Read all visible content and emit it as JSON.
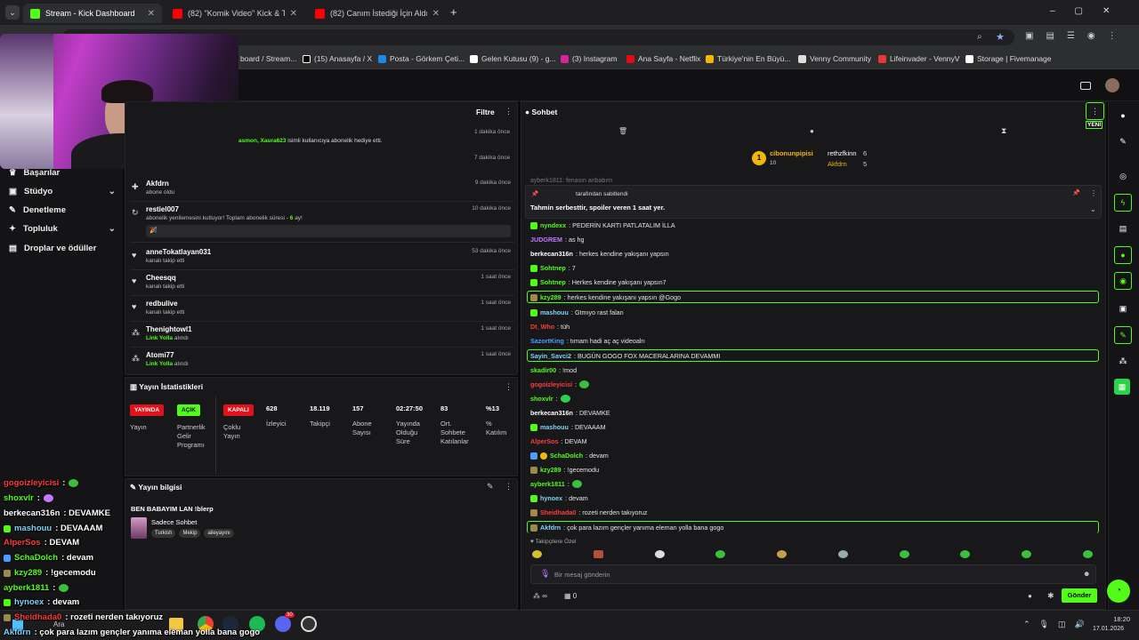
{
  "browser": {
    "tabs": [
      {
        "label": "Stream - Kick Dashboard"
      },
      {
        "label": "(82) \"Komik Video\" Kick & Twitc"
      },
      {
        "label": "(82) Canım İstediği İçin Aldıkla"
      }
    ],
    "bookmarks": [
      "board / Stream...",
      "(15) Anasayfa / X",
      "Posta - Görkem Çeti...",
      "Gelen Kutusu (9) - g...",
      "(3) Instagram",
      "Ana Sayfa - Netflix",
      "Türkiye'nin En Büyü...",
      "Venny Community",
      "Lifeinvader - VennyV",
      "Storage | Fivemanage"
    ]
  },
  "sidebar": {
    "items": [
      "Başarılar",
      "Stüdyo",
      "Denetleme",
      "Topluluk",
      "Droplar ve ödüller"
    ]
  },
  "activity": {
    "filter_label": "Filtre",
    "first_time": "1 dakika önce",
    "gift_text_names": "asmon, Xaura623",
    "gift_text": "isimli kullanıcıya abonelik hediye etti.",
    "second_time": "7 dakika önce",
    "rows": [
      {
        "name": "Akfdrn",
        "sub": "abone oldu",
        "time": "9 dakika önce"
      },
      {
        "name": "restiel007",
        "sub": "abonelik yenilemesini kutluyor! Toplam abonelik süresi -",
        "sub2": "6",
        "sub3": "ay!",
        "time": "10 dakika önce",
        "msg": "🎉"
      },
      {
        "name": "anneTokatlayan031",
        "sub": "kanalı takip etti",
        "time": "53 dakika önce"
      },
      {
        "name": "Cheesqq",
        "sub": "kanalı takip etti",
        "time": "1 saat önce"
      },
      {
        "name": "redbulive",
        "sub": "kanalı takip etti",
        "time": "1 saat önce"
      },
      {
        "name": "Thenightowl1",
        "sub": "Link Yolla",
        "sub_b": "alındı",
        "time": "1 saat önce"
      },
      {
        "name": "Atomi77",
        "sub": "Link Yolla",
        "sub_b": "alındı",
        "time": "1 saat önce"
      }
    ]
  },
  "stats": {
    "title": "Yayın İstatistikleri",
    "badges": [
      {
        "label": "YAYINDA",
        "caption": "Yayın"
      },
      {
        "label": "AÇIK",
        "caption": "Partnerlik Gelir Programı"
      },
      {
        "label": "KAPALI",
        "caption": "Çoklu Yayın"
      }
    ],
    "values": [
      {
        "v": "628",
        "l": "İzleyici"
      },
      {
        "v": "18.119",
        "l": "Takipçi"
      },
      {
        "v": "157",
        "l": "Abone Sayısı"
      },
      {
        "v": "02:27:50",
        "l": "Yayında Olduğu Süre"
      },
      {
        "v": "83",
        "l": "Ort. Sohbete Katılanlar"
      },
      {
        "v": "%13",
        "l": "% Katılım"
      }
    ]
  },
  "info": {
    "title": "Yayın bilgisi",
    "stream_title": "BEN BABAYIM LAN !blerp",
    "category": "Sadece Sohbet",
    "tags": [
      "Turkish",
      "Mekip",
      "aileyayını"
    ]
  },
  "chat": {
    "title": "Sohbet",
    "new_label": "YENİ",
    "top1": {
      "name": "cibonunpipisi",
      "score": "10"
    },
    "top2": {
      "name": "rethzfkinn",
      "score": "6"
    },
    "top3": {
      "name": "Akfdrn",
      "score": "5"
    },
    "pinned_partial": "ayberk1811: fenasın anbabım",
    "pinned_by": "tarafından sabitlendi",
    "pinned_text": "Tahmin serbesttir, spoiler veren 1 saat yer.",
    "messages": [
      {
        "u": "nyndexx",
        "t": ": PEDERİN KARTI PATLATALIM İLLA",
        "c": "#53fc18"
      },
      {
        "u": "JUDGREM",
        "t": ": as hg",
        "c": "#c678ff"
      },
      {
        "u": "berkecan316n",
        "t": ": herkes kendine yakışanı yapsın",
        "c": "#ffffff"
      },
      {
        "u": "Sohtnep",
        "t": ": 7",
        "c": "#53fc18"
      },
      {
        "u": "Sohtnep",
        "t": ": Herkes kendine yakışanı yapsın7",
        "c": "#53fc18"
      },
      {
        "u": "kzy289",
        "t": ": herkes kendine yakışanı yapsın @Gogo",
        "c": "#53fc18"
      },
      {
        "u": "mashouu",
        "t": ": Gtmıyo rast falan",
        "c": "#7fd3f7"
      },
      {
        "u": "Dt_Who",
        "t": ": tüh",
        "c": "#ff3b3b"
      },
      {
        "u": "SazortKing",
        "t": ": tımam hadi aç aç videoalrı",
        "c": "#4d9cff"
      },
      {
        "u": "Sayin_Savci2",
        "t": ": BUGÜN GOGO FOX MACERALARINA DEVAMMI",
        "c": "#7fd3f7"
      },
      {
        "u": "skadir00",
        "t": ": !mod",
        "c": "#53fc18"
      },
      {
        "u": "gogoizleyicisi",
        "t": ":",
        "c": "#ff3b3b"
      },
      {
        "u": "shoxvlr",
        "t": ":",
        "c": "#53fc18"
      },
      {
        "u": "berkecan316n",
        "t": ": DEVAMKE",
        "c": "#ffffff"
      },
      {
        "u": "mashouu",
        "t": ": DEVAAAM",
        "c": "#7fd3f7"
      },
      {
        "u": "AlperSos",
        "t": ": DEVAM",
        "c": "#ff3b3b"
      },
      {
        "u": "SchaDolch",
        "t": ": devam",
        "c": "#53fc18"
      },
      {
        "u": "kzy289",
        "t": ": !gecemodu",
        "c": "#53fc18"
      },
      {
        "u": "ayberk1811",
        "t": ":",
        "c": "#53fc18"
      },
      {
        "u": "hynoex",
        "t": ": devam",
        "c": "#7fd3f7"
      },
      {
        "u": "Sheidhada0",
        "t": ": rozeti nerden takıyoruz",
        "c": "#ff3b3b"
      },
      {
        "u": "Akfdrn",
        "t": ": çok para lazım gençler yanıma eleman yolla bana gogo",
        "c": "#7fd3f7"
      }
    ],
    "emote_label": "Takipçilere Özel",
    "input_placeholder": "Bir mesaj gönderin",
    "send_label": "Gönder",
    "points": "0"
  },
  "overlay": [
    {
      "u": "gogoizleyicisi",
      "t": ":",
      "c": "#ff3b3b"
    },
    {
      "u": "shoxvlr",
      "t": ":",
      "c": "#53fc18"
    },
    {
      "u": "berkecan316n",
      "t": ": DEVAMKE",
      "c": "#ffffff"
    },
    {
      "u": "mashouu",
      "t": ": DEVAAAM",
      "c": "#7fd3f7"
    },
    {
      "u": "AlperSos",
      "t": ": DEVAM",
      "c": "#ff3b3b"
    },
    {
      "u": "SchaDolch",
      "t": ": devam",
      "c": "#53fc18"
    },
    {
      "u": "kzy289",
      "t": ": !gecemodu",
      "c": "#53fc18"
    },
    {
      "u": "ayberk1811",
      "t": ":",
      "c": "#53fc18"
    },
    {
      "u": "hynoex",
      "t": ": devam",
      "c": "#7fd3f7"
    },
    {
      "u": "Sheidhada0",
      "t": ": rozeti nerden takıyoruz",
      "c": "#ff3b3b"
    },
    {
      "u": "Akfdrn",
      "t": ": çok para lazım gençler yanıma eleman yolla bana gogo",
      "c": "#7fd3f7"
    }
  ],
  "taskbar": {
    "search": "Ara",
    "time": "18:20",
    "date": "17.01.2026",
    "badge": "30"
  }
}
